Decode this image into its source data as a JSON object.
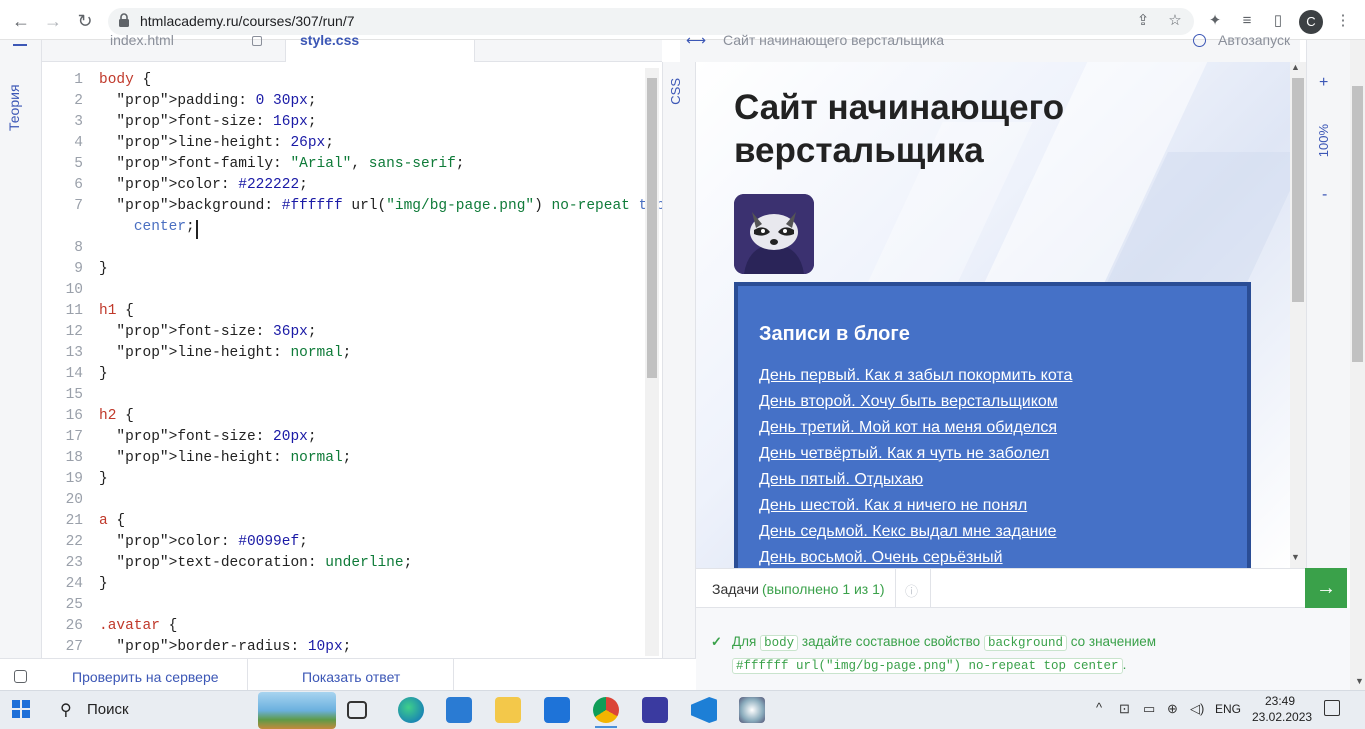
{
  "browser": {
    "url": "htmlacademy.ru/courses/307/run/7",
    "profile_initial": "C"
  },
  "sidebar": {
    "theory_label": "Теория"
  },
  "editor": {
    "tabs": [
      {
        "label": "index.html",
        "active": false
      },
      {
        "label": "style.css",
        "active": true
      }
    ],
    "side_tab_label": "CSS",
    "line_numbers": [
      "1",
      "2",
      "3",
      "4",
      "5",
      "6",
      "7",
      "",
      "8",
      "9",
      "10",
      "11",
      "12",
      "13",
      "14",
      "15",
      "16",
      "17",
      "18",
      "19",
      "20",
      "21",
      "22",
      "23",
      "24",
      "25",
      "26",
      "27"
    ],
    "lines": [
      "body {",
      "  padding: 0 30px;",
      "  font-size: 16px;",
      "  line-height: 26px;",
      "  font-family: \"Arial\", sans-serif;",
      "  color: #222222;",
      "  background: #ffffff url(\"img/bg-page.png\") no-repeat top",
      "    center;",
      "",
      "}",
      "",
      "h1 {",
      "  font-size: 36px;",
      "  line-height: normal;",
      "}",
      "",
      "h2 {",
      "  font-size: 20px;",
      "  line-height: normal;",
      "}",
      "",
      "a {",
      "  color: #0099ef;",
      "  text-decoration: underline;",
      "}",
      "",
      ".avatar {",
      "  border-radius: 10px;"
    ]
  },
  "preview": {
    "header_title": "Сайт начинающего верстальщика",
    "autorun_label": "Автозапуск",
    "page_title": "Сайт начинающего верстальщика",
    "blog_heading": "Записи в блоге",
    "blog_links": [
      "День первый. Как я забыл покормить кота",
      "День второй. Хочу быть верстальщиком",
      "День третий. Мой кот на меня обиделся",
      "День четвёртый. Как я чуть не заболел",
      "День пятый. Отдыхаю",
      "День шестой. Как я ничего не понял",
      "День седьмой. Кекс выдал мне задание",
      "День восьмой. Очень серьёзный"
    ],
    "zoom_label": "100%",
    "zoom_plus": "+",
    "zoom_minus": "-"
  },
  "tasks": {
    "label": "Задачи",
    "status": "(выполнено 1 из 1)",
    "task_text_1": "Для",
    "task_code_1": "body",
    "task_text_2": "задайте составное свойство",
    "task_code_2": "background",
    "task_text_3": "со значением",
    "task_code_3": "#ffffff url(\"img/bg-page.png\") no-repeat top center",
    "task_text_4": "."
  },
  "bottom_bar": {
    "check_button": "Проверить на сервере",
    "answer_button": "Показать ответ"
  },
  "taskbar": {
    "search_label": "Поиск",
    "language": "ENG",
    "time": "23:49",
    "date": "23.02.2023"
  },
  "colors": {
    "accent": "#3c57b6",
    "success": "#3aa14a",
    "blog_box": "#4571c7"
  }
}
